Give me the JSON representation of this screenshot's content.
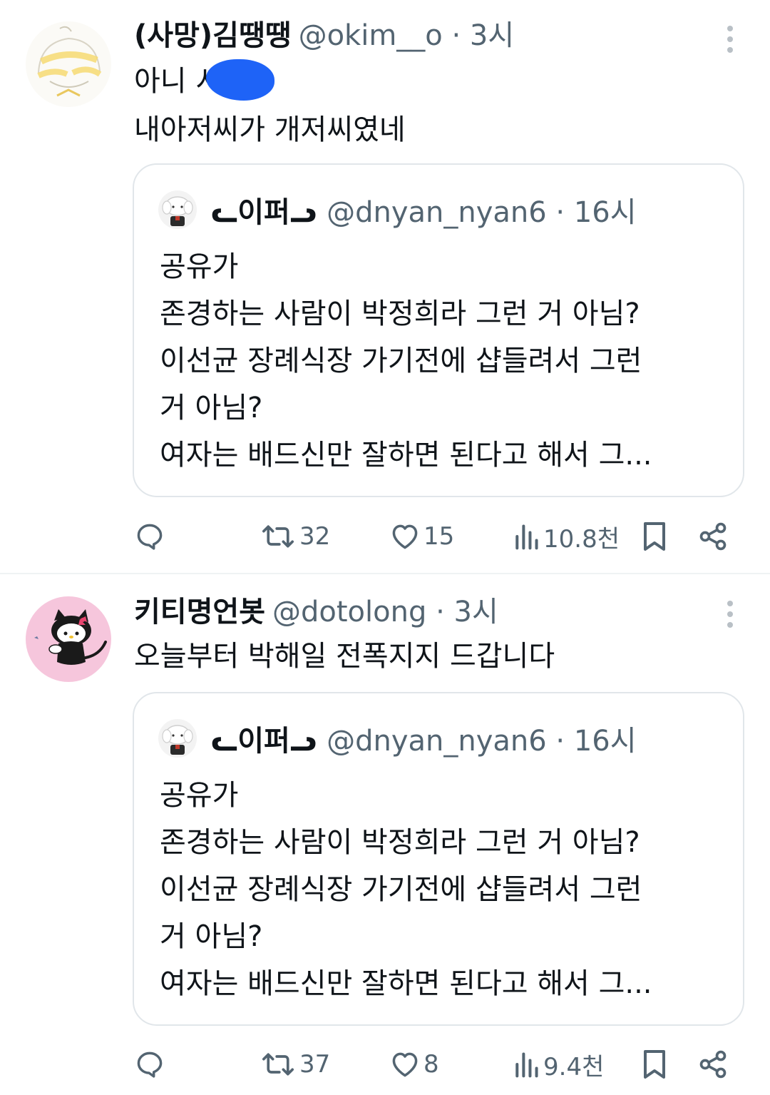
{
  "tweets": [
    {
      "author_name": "(사망)김땡땡",
      "author_meta": "@okim__o · 3시",
      "lines": [
        "아니 시",
        "내아저씨가 개저씨였네"
      ],
      "quote": {
        "name": "ᓚ이퍼ᓗ",
        "meta": "@dnyan_nyan6 · 16시",
        "lines": [
          "공유가",
          "존경하는 사람이 박정희라 그런 거 아님?",
          "이선균 장례식장 가기전에 샵들려서 그런",
          "거 아님?",
          "여자는 배드신만 잘하면 된다고 해서 그..."
        ]
      },
      "stats": {
        "retweets": "32",
        "likes": "15",
        "views": "10.8천"
      }
    },
    {
      "author_name": "키티명언봇",
      "author_meta": "@dotolong · 3시",
      "lines": [
        "오늘부터 박해일 전폭지지 드갑니다"
      ],
      "quote": {
        "name": "ᓚ이퍼ᓗ",
        "meta": "@dnyan_nyan6 · 16시",
        "lines": [
          "공유가",
          "존경하는 사람이 박정희라 그런 거 아님?",
          "이선균 장례식장 가기전에 샵들려서 그런",
          "거 아님?",
          "여자는 배드신만 잘하면 된다고 해서 그..."
        ]
      },
      "stats": {
        "retweets": "37",
        "likes": "8",
        "views": "9.4천"
      }
    }
  ],
  "icons": {
    "reply": "reply-icon",
    "retweet": "retweet-icon",
    "like": "heart-icon",
    "views": "views-icon",
    "bookmark": "bookmark-icon",
    "share": "share-icon",
    "more": "more-icon"
  },
  "colors": {
    "text": "#0f1419",
    "secondary": "#536471",
    "border": "#e1e6ea",
    "censor": "#1e63f7"
  }
}
